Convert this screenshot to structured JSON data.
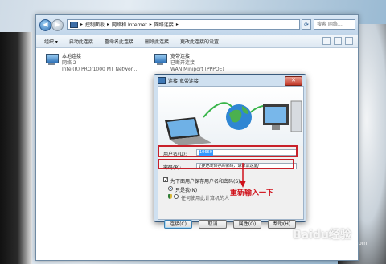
{
  "address": {
    "crumbs": [
      "控制面板",
      "网络和 Internet",
      "网络连接"
    ],
    "separator": "▸",
    "search_placeholder": "搜索 网络…"
  },
  "toolbar": {
    "items": [
      "组织 ▾",
      "启动此连接",
      "重命名此连接",
      "删除此连接",
      "更改此连接的设置"
    ]
  },
  "connections": [
    {
      "name": "本地连接",
      "line2": "网络 2",
      "line3": "Intel(R) PRO/1000 MT Networ..."
    },
    {
      "name": "宽带连接",
      "line2": "已断开连接",
      "line3": "WAN Miniport (PPPOE)"
    }
  ],
  "dialog": {
    "title": "连接 宽带连接",
    "close_label": "✕",
    "username_label": "用户名(U):",
    "username_value": "10660",
    "password_label": "密码(P):",
    "password_hint": "[要更改保存的密码，请单击这里]",
    "save_checkbox_label": "为下面用户保存用户名和密码(S):",
    "radio_only_me": "只是我(N)",
    "radio_anyone": "任何使用此计算机的人",
    "buttons": {
      "connect": "连接(C)",
      "cancel": "取消",
      "properties": "属性(O)",
      "help": "帮助(H)"
    }
  },
  "annotation": "重新输入一下",
  "watermark": {
    "main": "Baidu经验",
    "sub": "jingyan.baidu.com"
  },
  "colors": {
    "highlight": "#c8202a",
    "selection": "#3399ff"
  }
}
